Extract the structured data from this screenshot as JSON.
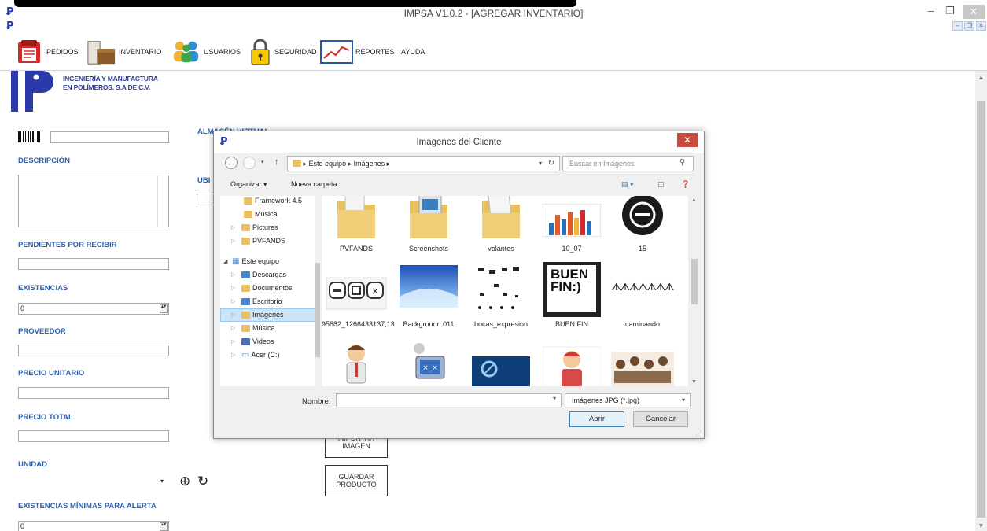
{
  "window": {
    "title": "IMPSA V1.0.2 - [AGREGAR INVENTARIO]",
    "min": "–",
    "max": "❐",
    "close": "✕",
    "mdi": [
      "–",
      "❐",
      "✕"
    ]
  },
  "menu": {
    "items": [
      {
        "label": "PEDIDOS",
        "icon": "orders-icon"
      },
      {
        "label": "INVENTARIO",
        "icon": "inventory-icon"
      },
      {
        "label": "USUARIOS",
        "icon": "users-icon"
      },
      {
        "label": "SEGURIDAD",
        "icon": "lock-icon"
      },
      {
        "label": "REPORTES",
        "icon": "chart-icon"
      },
      {
        "label": "AYUDA",
        "icon": ""
      }
    ]
  },
  "company": {
    "name_line1": "INGENIERÍA Y MANUFACTURA",
    "name_line2": "EN POLÍMEROS. S.A DE C.V."
  },
  "form": {
    "descripcion": "DESCRIPCIÓN",
    "pendientes": "PENDIENTES POR RECIBIR",
    "existencias": "EXISTENCIAS",
    "existencias_value": "0",
    "proveedor": "PROVEEDOR",
    "precio_unitario": "PRECIO UNITARIO",
    "precio_total": "PRECIO TOTAL",
    "unidad": "UNIDAD",
    "existencias_minimas": "EXISTENCIAS MÍNIMAS PARA ALERTA",
    "existencias_minimas_value": "0",
    "almacen_virtual": "ALMACÉN VIRTUAL",
    "ubicacion": "UBI",
    "importar_imagen": "IMPORTAR IMAGEN",
    "guardar_producto": "GUARDAR PRODUCTO"
  },
  "dialog": {
    "title": "Imagenes del Cliente",
    "close": "✕",
    "address": "▸ Este equipo ▸ Imágenes ▸",
    "search_placeholder": "Buscar en Imágenes",
    "organize": "Organizar ▾",
    "new_folder": "Nueva carpeta",
    "tree": [
      {
        "label": "Framework 4.5",
        "selected": false
      },
      {
        "label": "Música",
        "selected": false
      },
      {
        "label": "Pictures",
        "selected": false
      },
      {
        "label": "PVFANDS",
        "selected": false
      },
      {
        "label": "Este equipo",
        "selected": false
      },
      {
        "label": "Descargas",
        "selected": false
      },
      {
        "label": "Documentos",
        "selected": false
      },
      {
        "label": "Escritorio",
        "selected": false
      },
      {
        "label": "Imágenes",
        "selected": true
      },
      {
        "label": "Música",
        "selected": false
      },
      {
        "label": "Videos",
        "selected": false
      },
      {
        "label": "Acer (C:)",
        "selected": false
      }
    ],
    "files": [
      {
        "label": "PVFANDS",
        "kind": "folder"
      },
      {
        "label": "Screenshots",
        "kind": "folder"
      },
      {
        "label": "volantes",
        "kind": "folder"
      },
      {
        "label": "10_07",
        "kind": "chart"
      },
      {
        "label": "15",
        "kind": "circle"
      },
      {
        "label": "95882_1266433137,13",
        "kind": "buttons"
      },
      {
        "label": "Background 011",
        "kind": "blue"
      },
      {
        "label": "bocas_expresion",
        "kind": "dots"
      },
      {
        "label": "BUEN FIN",
        "kind": "buenfin"
      },
      {
        "label": "caminando",
        "kind": "walk"
      },
      {
        "label": "",
        "kind": "man"
      },
      {
        "label": "",
        "kind": "robot"
      },
      {
        "label": "",
        "kind": "darkblue"
      },
      {
        "label": "",
        "kind": "man2"
      },
      {
        "label": "",
        "kind": "group"
      }
    ],
    "buenfin_text": "BUEN FIN:)",
    "walk_text": "ᗑᗑᗑᗑᗑᗑᗑ",
    "name_label": "Nombre:",
    "filter": "Imágenes JPG (*.jpg)",
    "open": "Abrir",
    "cancel": "Cancelar"
  }
}
